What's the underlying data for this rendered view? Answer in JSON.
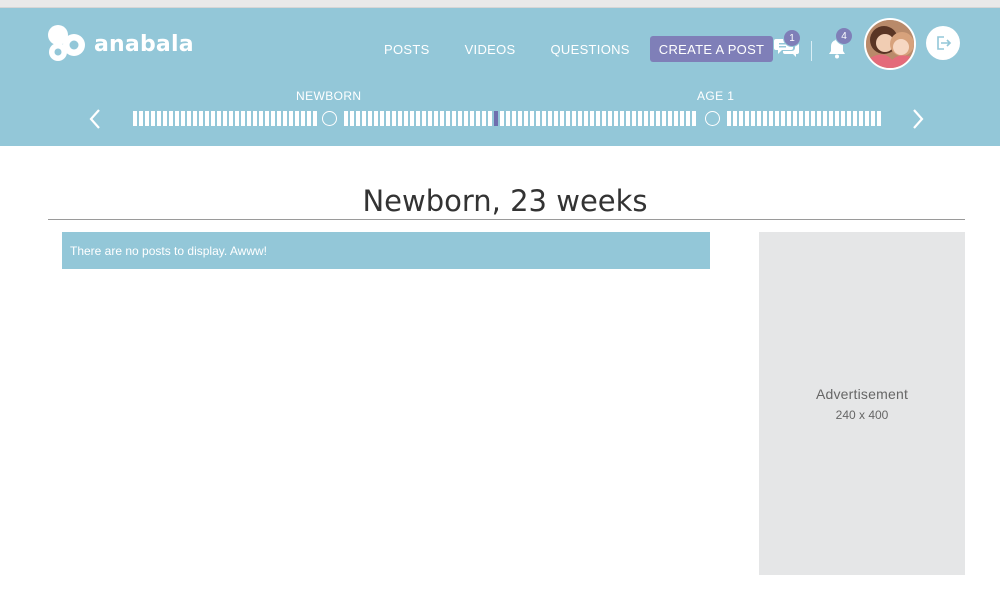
{
  "brand": {
    "name": "anabala"
  },
  "nav": {
    "items": [
      {
        "label": "POSTS"
      },
      {
        "label": "VIDEOS"
      },
      {
        "label": "QUESTIONS"
      }
    ],
    "create_label": "CREATE A POST"
  },
  "header_icons": {
    "messages": {
      "icon": "chat-icon",
      "badge": "1"
    },
    "notifications": {
      "icon": "bell-icon",
      "badge": "4"
    },
    "logout": {
      "icon": "logout-icon"
    }
  },
  "timeline": {
    "labels": [
      "NEWBORN",
      "AGE 1"
    ],
    "current_week": 23
  },
  "page": {
    "title": "Newborn, 23 weeks",
    "empty_message": "There are no posts to display. Awww!"
  },
  "ad": {
    "title": "Advertisement",
    "size": "240 x 400"
  },
  "colors": {
    "header": "#93c7d8",
    "accent": "#7f7fb8",
    "ad_background": "#e5e6e7"
  }
}
